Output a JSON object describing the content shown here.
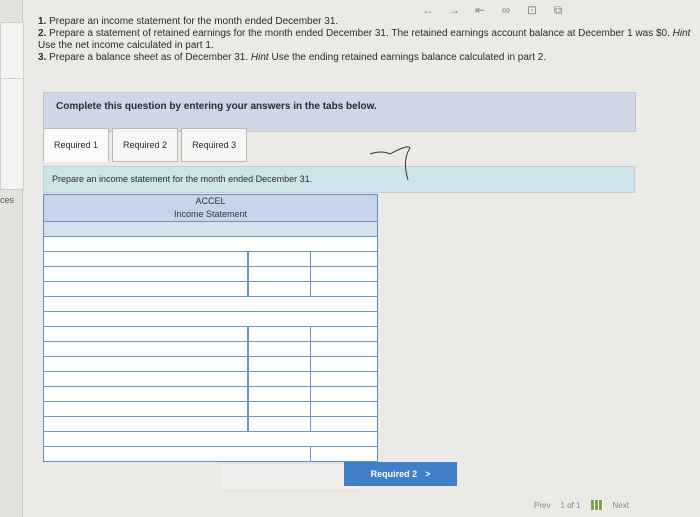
{
  "sidebar": {
    "label": "ces"
  },
  "toolbar": {
    "icons": [
      "back-arrow-icon",
      "forward-arrow-icon",
      "first-icon",
      "network-icon",
      "comment-icon",
      "expand-icon"
    ],
    "glyphs": [
      "←",
      "→",
      "⇤",
      "∞",
      "⊡",
      "⧉"
    ]
  },
  "instructions": {
    "line1_num": "1.",
    "line1": "Prepare an income statement for the month ended December 31.",
    "line2_num": "2.",
    "line2": "Prepare a statement of retained earnings for the month ended December 31. The retained earnings account balance at December 1 was $0.",
    "line2_hint_label": "Hint",
    "line2_hint": "Use the net income calculated in part 1.",
    "line3_num": "3.",
    "line3": "Prepare a balance sheet as of December 31.",
    "line3_hint_label": "Hint",
    "line3_hint": "Use the ending retained earnings balance calculated in part 2."
  },
  "banner": {
    "text": "Complete this question by entering your answers in the tabs below."
  },
  "tabs": [
    {
      "label": "Required 1"
    },
    {
      "label": "Required 2"
    },
    {
      "label": "Required 3"
    }
  ],
  "prompt": {
    "text": "Prepare an income statement for the month ended December 31."
  },
  "statement": {
    "company": "ACCEL",
    "title": "Income Statement"
  },
  "nav": {
    "next_tab_label": "Required 2",
    "next_tab_arrow": ">",
    "prev": "Prev",
    "page": "1",
    "of": "of",
    "total": "1",
    "next": "Next"
  }
}
